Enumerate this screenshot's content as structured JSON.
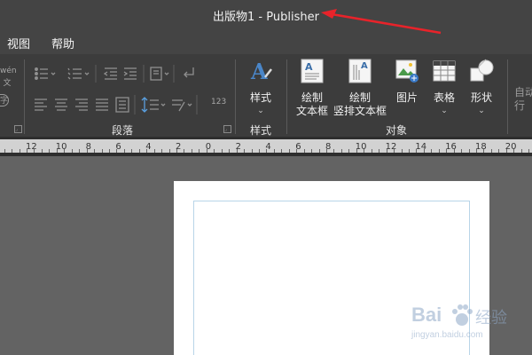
{
  "window": {
    "title": "出版物1  -  Publisher"
  },
  "menu": {
    "items": [
      "视图",
      "帮助"
    ]
  },
  "ribbon": {
    "wen_icon_label": "wén\n文",
    "zi_icon_label": "字",
    "paragraph_group": "段落",
    "styles": {
      "label": "样式",
      "group": "样式"
    },
    "objects": {
      "group": "对象",
      "draw_textbox": "绘制\n文本框",
      "draw_vertical_textbox": "绘制\n竖排文本框",
      "picture": "图片",
      "table": "表格",
      "shapes": "形状",
      "auto_flow": "自动\n行"
    },
    "number_label": "123"
  },
  "ruler": {
    "labels": [
      "12",
      "10",
      "8",
      "6",
      "4",
      "2",
      "0",
      "2",
      "4",
      "6",
      "8",
      "10",
      "12",
      "14",
      "16",
      "18",
      "20",
      "22"
    ]
  },
  "watermark": {
    "brand": "Bai",
    "brand2": "经验",
    "url": "jingyan.baidu.com"
  },
  "colors": {
    "accent_arrow": "#e8232a",
    "ribbon_bg": "#3c3c3c",
    "title_bg": "#444444"
  }
}
